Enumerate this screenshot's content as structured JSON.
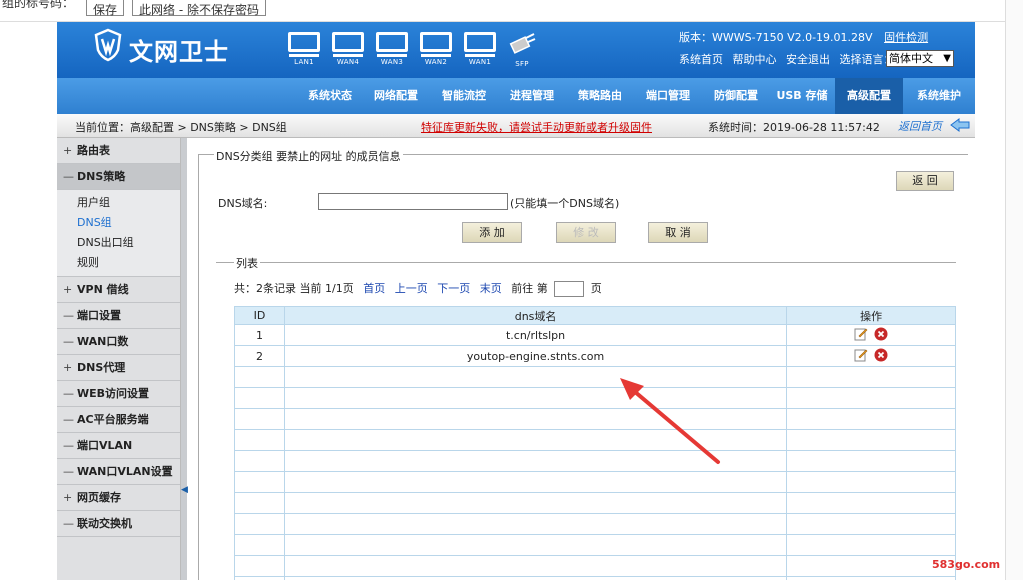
{
  "top_strip": {
    "cut_text": "组的标号码：",
    "btn1": "保存",
    "btn2": "此网络 - 除不保存密码"
  },
  "header": {
    "logo": "文网卫士",
    "ports": [
      "LAN1",
      "WAN4",
      "WAN3",
      "WAN2",
      "WAN1",
      "SFP"
    ],
    "version": "版本：WWWS-7150 V2.0-19.01.28V",
    "firmware_check": "固件检测",
    "links": [
      "系统首页",
      "帮助中心",
      "安全退出",
      "选择语言："
    ],
    "language": "简体中文"
  },
  "nav": {
    "items": [
      "系统状态",
      "网络配置",
      "智能流控",
      "进程管理",
      "策略路由",
      "端口管理",
      "防御配置",
      "USB 存储",
      "高级配置",
      "系统维护"
    ],
    "active_index": 8
  },
  "crumb_bar": {
    "crumb": "当前位置：高级配置 > DNS策略 > DNS组",
    "warning": "特征库更新失败，请尝试手动更新或者升级固件",
    "time": "系统时间：2019-06-28 11:57:42",
    "back_home": "返回首页"
  },
  "sidebar": {
    "items": [
      {
        "sign": "+",
        "label": "路由表"
      },
      {
        "sign": "—",
        "label": "DNS策略",
        "open": true,
        "subs": [
          "用户组",
          "DNS组",
          "DNS出口组",
          "规则"
        ],
        "active_sub": 1
      },
      {
        "sign": "+",
        "label": "VPN 借线"
      },
      {
        "sign": "—",
        "label": "端口设置"
      },
      {
        "sign": "—",
        "label": "WAN口数"
      },
      {
        "sign": "+",
        "label": "DNS代理"
      },
      {
        "sign": "—",
        "label": "WEB访问设置"
      },
      {
        "sign": "—",
        "label": "AC平台服务端"
      },
      {
        "sign": "—",
        "label": "端口VLAN"
      },
      {
        "sign": "—",
        "label": "WAN口VLAN设置"
      },
      {
        "sign": "+",
        "label": "网页缓存"
      },
      {
        "sign": "—",
        "label": "联动交换机"
      }
    ]
  },
  "main": {
    "fieldset_title": "DNS分类组 要禁止的网址 的成员信息",
    "back_btn": "返  回",
    "dns_label": "DNS域名:",
    "dns_input_value": "",
    "dns_hint": "(只能填一个DNS域名)",
    "add_btn": "添  加",
    "modify_btn": "修  改",
    "cancel_btn": "取  消",
    "list_title": "列表",
    "pager_text": "共：2条记录 当前 1/1页",
    "pager_links": [
      "首页",
      "上一页",
      "下一页",
      "末页"
    ],
    "goto_label": "前往 第",
    "page_unit": "页",
    "table": {
      "headers": [
        "ID",
        "dns域名",
        "操作"
      ],
      "rows": [
        {
          "id": "1",
          "domain": "t.cn/rltslpn"
        },
        {
          "id": "2",
          "domain": "youtop-engine.stnts.com"
        }
      ],
      "empty_rows": 11
    }
  },
  "watermark": "583go.com"
}
